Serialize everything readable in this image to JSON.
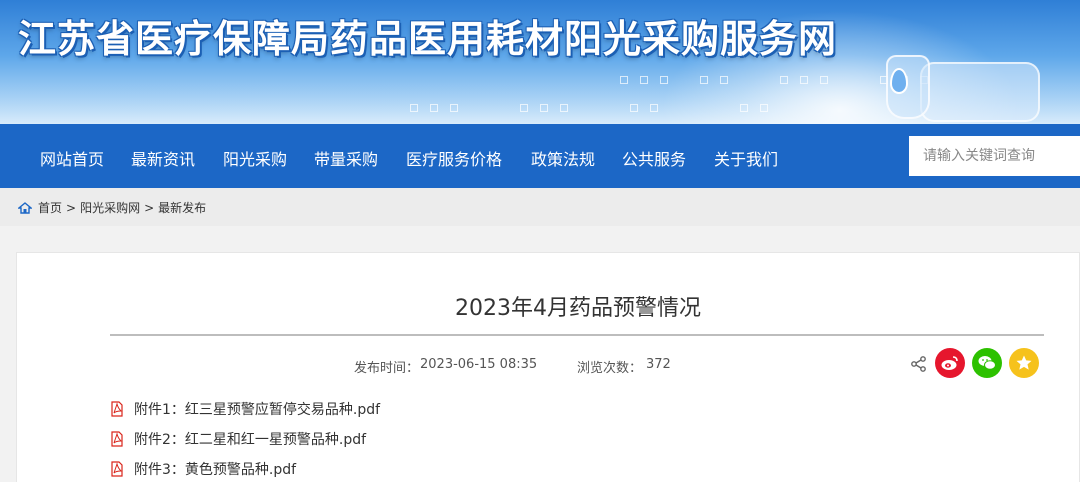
{
  "header": {
    "site_title": "江苏省医疗保障局药品医用耗材阳光采购服务网"
  },
  "nav": {
    "items": [
      {
        "label": "网站首页"
      },
      {
        "label": "最新资讯"
      },
      {
        "label": "阳光采购"
      },
      {
        "label": "带量采购"
      },
      {
        "label": "医疗服务价格"
      },
      {
        "label": "政策法规"
      },
      {
        "label": "公共服务"
      },
      {
        "label": "关于我们"
      }
    ],
    "search_placeholder": "请输入关键词查询"
  },
  "breadcrumb": {
    "items": [
      "首页",
      "阳光采购网",
      "最新发布"
    ],
    "separator": ">"
  },
  "article": {
    "title": "2023年4月药品预警情况",
    "publish_label": "发布时间：",
    "publish_time": "2023-06-15 08:35",
    "views_label": "浏览次数：",
    "views": "372",
    "attachments": [
      {
        "label": "附件1：红三星预警应暂停交易品种.pdf"
      },
      {
        "label": "附件2：红二星和红一星预警品种.pdf"
      },
      {
        "label": "附件3：黄色预警品种.pdf"
      }
    ]
  },
  "share": {
    "icons": [
      "share-icon",
      "weibo-icon",
      "wechat-icon",
      "qzone-icon"
    ],
    "colors": {
      "weibo": "#e6162d",
      "wechat": "#2dc100",
      "qzone": "#f6c21c"
    }
  },
  "colors": {
    "nav_bg": "#1c67c6",
    "banner_top": "#2f7fd6",
    "pdf_red": "#d9261c"
  }
}
